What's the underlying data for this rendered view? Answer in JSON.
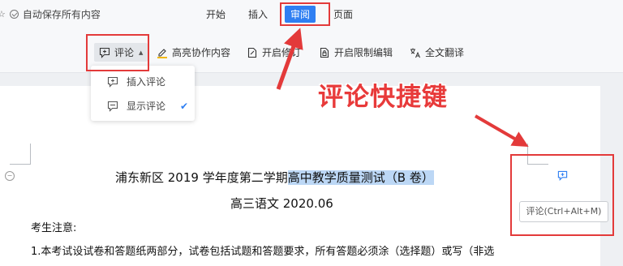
{
  "top_bar": {
    "save_status": "自动保存所有内容",
    "tabs": [
      {
        "label": "开始"
      },
      {
        "label": "插入"
      },
      {
        "label": "审阅",
        "active": true
      },
      {
        "label": "页面"
      }
    ]
  },
  "toolbar": {
    "comment": "评论",
    "highlight_collab": "高亮协作内容",
    "track_changes": "开启修订",
    "restrict_edit": "开启限制编辑",
    "translate": "全文翻译"
  },
  "comment_menu": {
    "insert_comment": "插入评论",
    "show_comments": "显示评论",
    "show_comments_checked": true
  },
  "document": {
    "title_plain": "浦东新区 2019 学年度第二学期",
    "title_highlighted": "高中教学质量测试（B 卷）",
    "subtitle": "高三语文  2020.06",
    "notice": "考生注意:",
    "line1": "1.本考试设试卷和答题纸两部分，试卷包括试题和答题要求，所有答题必须涂（选择题）或写（非选"
  },
  "annotation": {
    "text": "评论快捷键"
  },
  "tooltip": {
    "text": "评论(Ctrl+Alt+M)"
  },
  "colors": {
    "accent": "#2f7ff2",
    "annotation_red": "#e33a3a",
    "highlight": "#bcd7f5"
  }
}
